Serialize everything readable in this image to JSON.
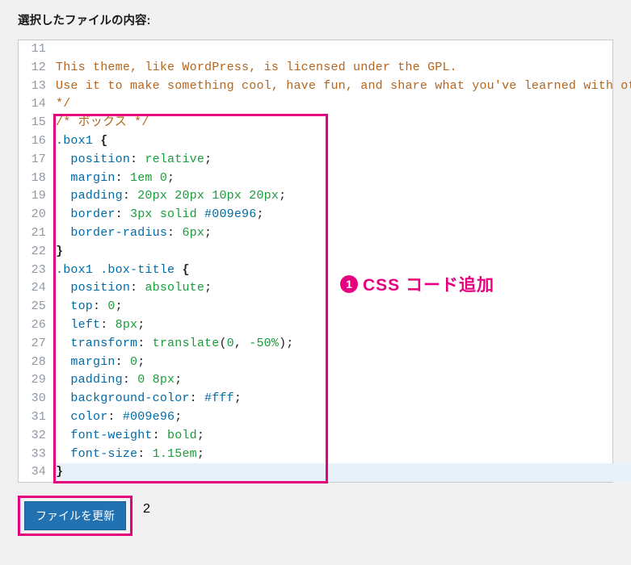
{
  "heading": "選択したファイルの内容:",
  "line_start": 11,
  "code_lines": [
    {
      "n": 11,
      "t": [
        {
          "c": "line",
          "txt": ""
        }
      ]
    },
    {
      "n": 12,
      "t": [
        {
          "c": "tok-comment",
          "txt": "This theme, like WordPress, is licensed under the GPL."
        }
      ]
    },
    {
      "n": 13,
      "t": [
        {
          "c": "tok-comment",
          "txt": "Use it to make something cool, have fun, and share what you've learned with others."
        }
      ]
    },
    {
      "n": 14,
      "t": [
        {
          "c": "tok-comment",
          "txt": "*/"
        }
      ]
    },
    {
      "n": 15,
      "t": [
        {
          "c": "tok-comment",
          "txt": "/* ボックス */"
        }
      ]
    },
    {
      "n": 16,
      "t": [
        {
          "c": "tok-sel",
          "txt": ".box1"
        },
        {
          "c": "",
          "txt": " "
        },
        {
          "c": "tok-brace",
          "txt": "{"
        }
      ]
    },
    {
      "n": 17,
      "t": [
        {
          "c": "",
          "txt": "  "
        },
        {
          "c": "tok-prop",
          "txt": "position"
        },
        {
          "c": "tok-colon",
          "txt": ": "
        },
        {
          "c": "tok-val",
          "txt": "relative"
        },
        {
          "c": "tok-punct",
          "txt": ";"
        }
      ]
    },
    {
      "n": 18,
      "t": [
        {
          "c": "",
          "txt": "  "
        },
        {
          "c": "tok-prop",
          "txt": "margin"
        },
        {
          "c": "tok-colon",
          "txt": ": "
        },
        {
          "c": "tok-val",
          "txt": "1em 0"
        },
        {
          "c": "tok-punct",
          "txt": ";"
        }
      ]
    },
    {
      "n": 19,
      "t": [
        {
          "c": "",
          "txt": "  "
        },
        {
          "c": "tok-prop",
          "txt": "padding"
        },
        {
          "c": "tok-colon",
          "txt": ": "
        },
        {
          "c": "tok-val",
          "txt": "20px 20px 10px 20px"
        },
        {
          "c": "tok-punct",
          "txt": ";"
        }
      ]
    },
    {
      "n": 20,
      "t": [
        {
          "c": "",
          "txt": "  "
        },
        {
          "c": "tok-prop",
          "txt": "border"
        },
        {
          "c": "tok-colon",
          "txt": ": "
        },
        {
          "c": "tok-val",
          "txt": "3px solid "
        },
        {
          "c": "tok-valstr",
          "txt": "#009e96"
        },
        {
          "c": "tok-punct",
          "txt": ";"
        }
      ]
    },
    {
      "n": 21,
      "t": [
        {
          "c": "",
          "txt": "  "
        },
        {
          "c": "tok-prop",
          "txt": "border-radius"
        },
        {
          "c": "tok-colon",
          "txt": ": "
        },
        {
          "c": "tok-val",
          "txt": "6px"
        },
        {
          "c": "tok-punct",
          "txt": ";"
        }
      ]
    },
    {
      "n": 22,
      "t": [
        {
          "c": "tok-brace",
          "txt": "}"
        }
      ]
    },
    {
      "n": 23,
      "t": [
        {
          "c": "tok-sel",
          "txt": ".box1 .box-title"
        },
        {
          "c": "",
          "txt": " "
        },
        {
          "c": "tok-brace",
          "txt": "{"
        }
      ]
    },
    {
      "n": 24,
      "t": [
        {
          "c": "",
          "txt": "  "
        },
        {
          "c": "tok-prop",
          "txt": "position"
        },
        {
          "c": "tok-colon",
          "txt": ": "
        },
        {
          "c": "tok-val",
          "txt": "absolute"
        },
        {
          "c": "tok-punct",
          "txt": ";"
        }
      ]
    },
    {
      "n": 25,
      "t": [
        {
          "c": "",
          "txt": "  "
        },
        {
          "c": "tok-prop",
          "txt": "top"
        },
        {
          "c": "tok-colon",
          "txt": ": "
        },
        {
          "c": "tok-val",
          "txt": "0"
        },
        {
          "c": "tok-punct",
          "txt": ";"
        }
      ]
    },
    {
      "n": 26,
      "t": [
        {
          "c": "",
          "txt": "  "
        },
        {
          "c": "tok-prop",
          "txt": "left"
        },
        {
          "c": "tok-colon",
          "txt": ": "
        },
        {
          "c": "tok-val",
          "txt": "8px"
        },
        {
          "c": "tok-punct",
          "txt": ";"
        }
      ]
    },
    {
      "n": 27,
      "t": [
        {
          "c": "",
          "txt": "  "
        },
        {
          "c": "tok-prop",
          "txt": "transform"
        },
        {
          "c": "tok-colon",
          "txt": ": "
        },
        {
          "c": "tok-val",
          "txt": "translate"
        },
        {
          "c": "tok-punct",
          "txt": "("
        },
        {
          "c": "tok-val",
          "txt": "0"
        },
        {
          "c": "tok-punct",
          "txt": ", "
        },
        {
          "c": "tok-val",
          "txt": "-50%"
        },
        {
          "c": "tok-punct",
          "txt": ");"
        }
      ]
    },
    {
      "n": 28,
      "t": [
        {
          "c": "",
          "txt": "  "
        },
        {
          "c": "tok-prop",
          "txt": "margin"
        },
        {
          "c": "tok-colon",
          "txt": ": "
        },
        {
          "c": "tok-val",
          "txt": "0"
        },
        {
          "c": "tok-punct",
          "txt": ";"
        }
      ]
    },
    {
      "n": 29,
      "t": [
        {
          "c": "",
          "txt": "  "
        },
        {
          "c": "tok-prop",
          "txt": "padding"
        },
        {
          "c": "tok-colon",
          "txt": ": "
        },
        {
          "c": "tok-val",
          "txt": "0 8px"
        },
        {
          "c": "tok-punct",
          "txt": ";"
        }
      ]
    },
    {
      "n": 30,
      "t": [
        {
          "c": "",
          "txt": "  "
        },
        {
          "c": "tok-prop",
          "txt": "background-color"
        },
        {
          "c": "tok-colon",
          "txt": ": "
        },
        {
          "c": "tok-valstr",
          "txt": "#fff"
        },
        {
          "c": "tok-punct",
          "txt": ";"
        }
      ]
    },
    {
      "n": 31,
      "t": [
        {
          "c": "",
          "txt": "  "
        },
        {
          "c": "tok-prop",
          "txt": "color"
        },
        {
          "c": "tok-colon",
          "txt": ": "
        },
        {
          "c": "tok-valstr",
          "txt": "#009e96"
        },
        {
          "c": "tok-punct",
          "txt": ";"
        }
      ]
    },
    {
      "n": 32,
      "t": [
        {
          "c": "",
          "txt": "  "
        },
        {
          "c": "tok-prop",
          "txt": "font-weight"
        },
        {
          "c": "tok-colon",
          "txt": ": "
        },
        {
          "c": "tok-val",
          "txt": "bold"
        },
        {
          "c": "tok-punct",
          "txt": ";"
        }
      ]
    },
    {
      "n": 33,
      "t": [
        {
          "c": "",
          "txt": "  "
        },
        {
          "c": "tok-prop",
          "txt": "font-size"
        },
        {
          "c": "tok-colon",
          "txt": ": "
        },
        {
          "c": "tok-val",
          "txt": "1.15em"
        },
        {
          "c": "tok-punct",
          "txt": ";"
        }
      ]
    },
    {
      "n": 34,
      "t": [
        {
          "c": "tok-brace",
          "txt": "}"
        }
      ],
      "hl": true
    }
  ],
  "callout1_num": "1",
  "callout1_text": "CSS コード追加",
  "callout2_num": "2",
  "button_label": "ファイルを更新"
}
